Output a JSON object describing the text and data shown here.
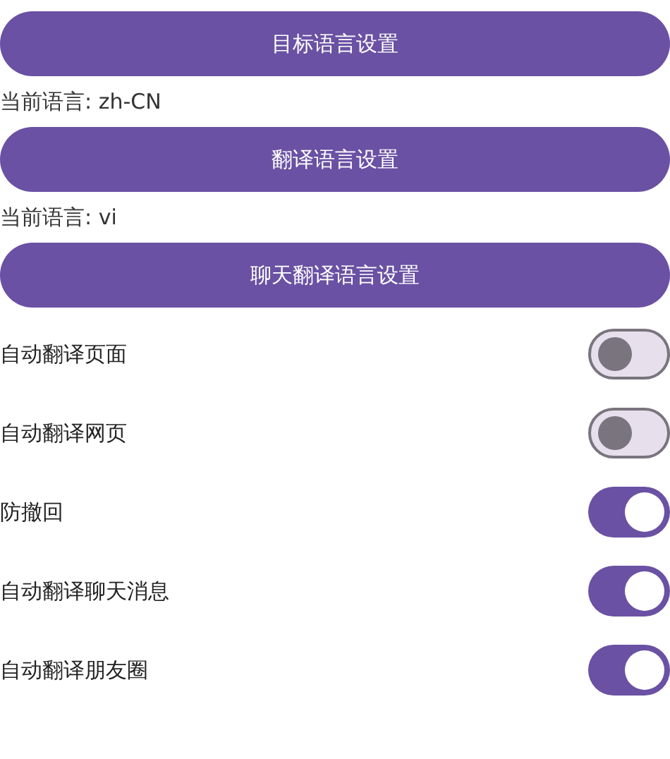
{
  "sections": [
    {
      "button": "目标语言设置",
      "current": "当前语言: zh-CN"
    },
    {
      "button": "翻译语言设置",
      "current": "当前语言: vi"
    },
    {
      "button": "聊天翻译语言设置"
    }
  ],
  "toggles": [
    {
      "label": "自动翻译页面",
      "on": false
    },
    {
      "label": "自动翻译网页",
      "on": false
    },
    {
      "label": "防撤回",
      "on": true
    },
    {
      "label": "自动翻译聊天消息",
      "on": true
    },
    {
      "label": "自动翻译朋友圈",
      "on": true
    }
  ]
}
